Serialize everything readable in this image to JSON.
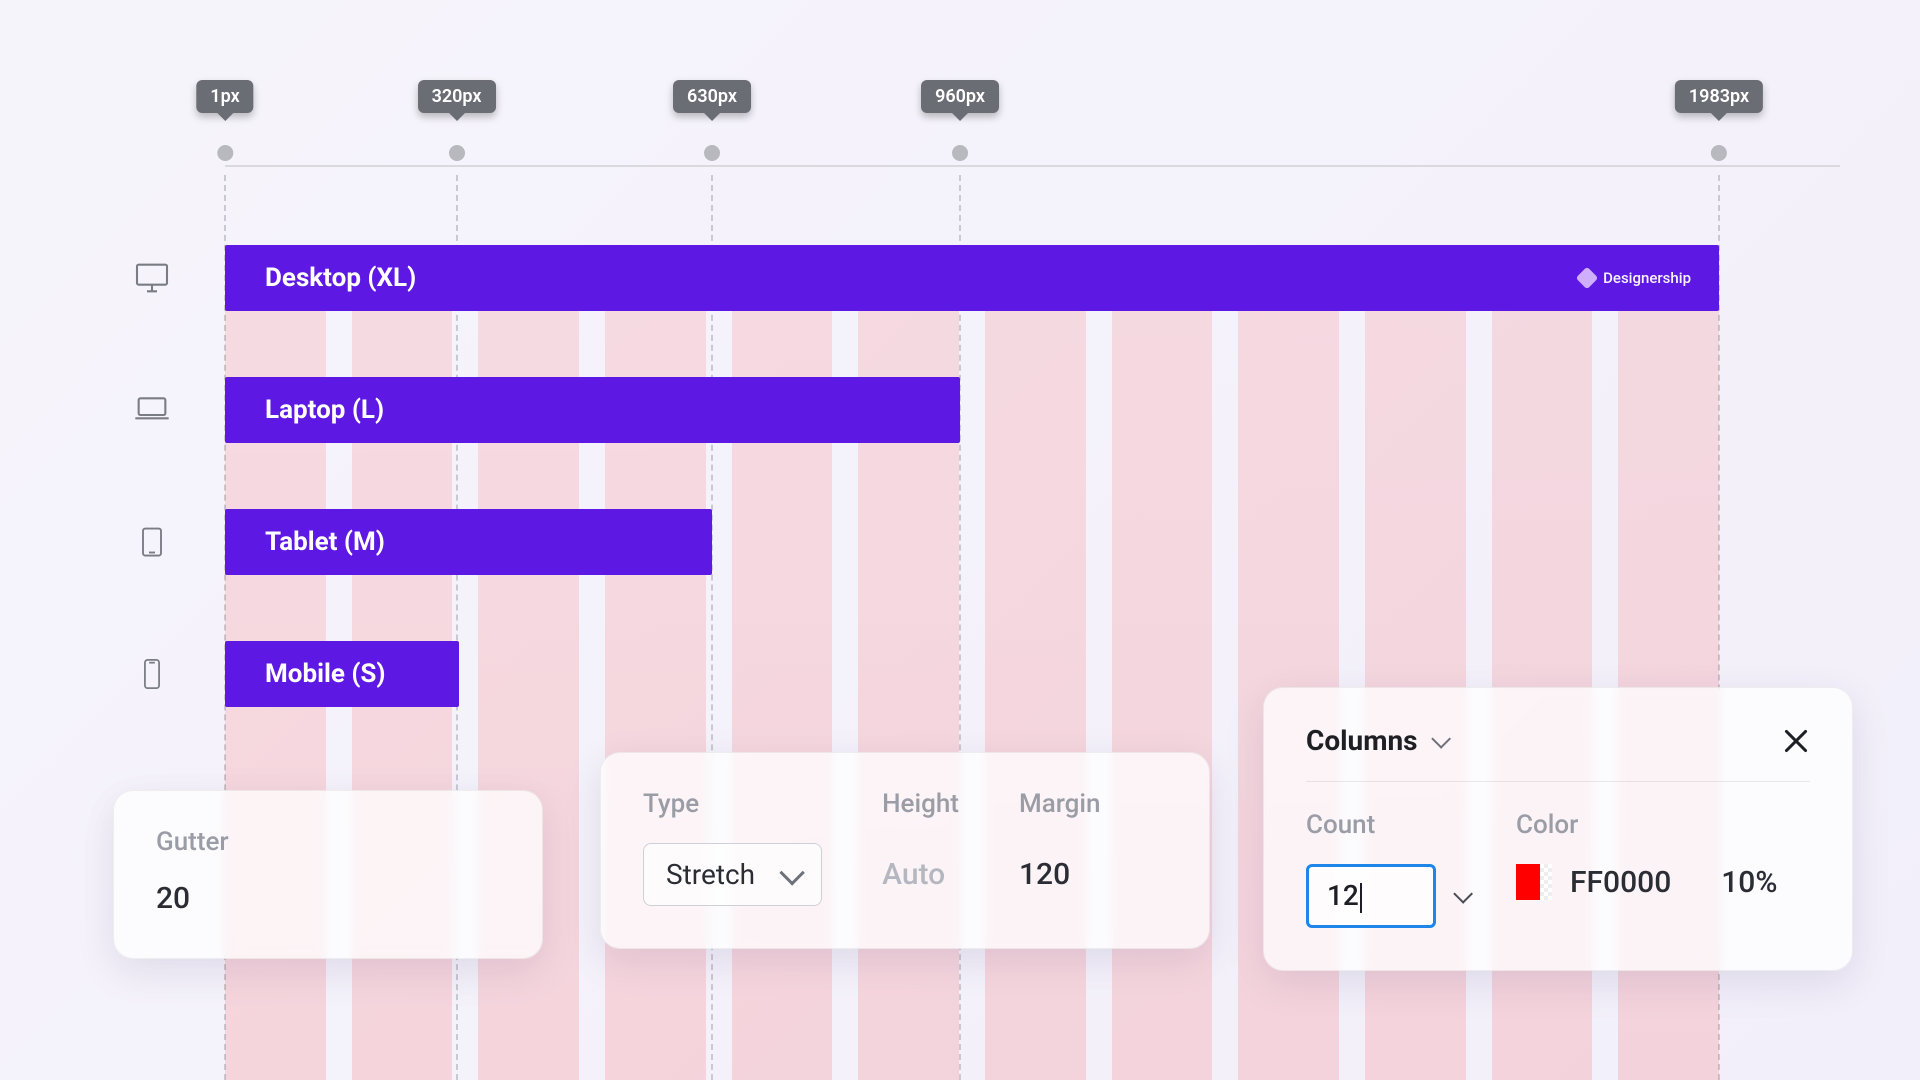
{
  "ruler": {
    "breakpoints": [
      {
        "label": "1px",
        "pct": 0
      },
      {
        "label": "320px",
        "pct": 15.5
      },
      {
        "label": "630px",
        "pct": 32.6
      },
      {
        "label": "960px",
        "pct": 49.2
      },
      {
        "label": "1983px",
        "pct": 100
      }
    ]
  },
  "bars": {
    "desktop": {
      "label": "Desktop (XL)",
      "widthPx": 1494
    },
    "laptop": {
      "label": "Laptop (L)",
      "widthPx": 735
    },
    "tablet": {
      "label": "Tablet (M)",
      "widthPx": 487
    },
    "mobile": {
      "label": "Mobile (S)",
      "widthPx": 234
    }
  },
  "brand": "Designership",
  "panelGutter": {
    "label": "Gutter",
    "value": "20"
  },
  "panelTHM": {
    "type": {
      "label": "Type",
      "value": "Stretch"
    },
    "height": {
      "label": "Height",
      "value": "Auto"
    },
    "margin": {
      "label": "Margin",
      "value": "120"
    }
  },
  "panelColumns": {
    "title": "Columns",
    "count": {
      "label": "Count",
      "value": "12"
    },
    "color": {
      "label": "Color",
      "hex": "FF0000",
      "opacity": "10%"
    }
  },
  "chart_data": {
    "type": "bar",
    "title": "Responsive breakpoint widths",
    "xlabel": "",
    "ylabel": "px",
    "categories": [
      "Mobile (S)",
      "Tablet (M)",
      "Laptop (L)",
      "Desktop (XL)"
    ],
    "values": [
      320,
      630,
      960,
      1983
    ],
    "ylim": [
      0,
      2000
    ]
  }
}
